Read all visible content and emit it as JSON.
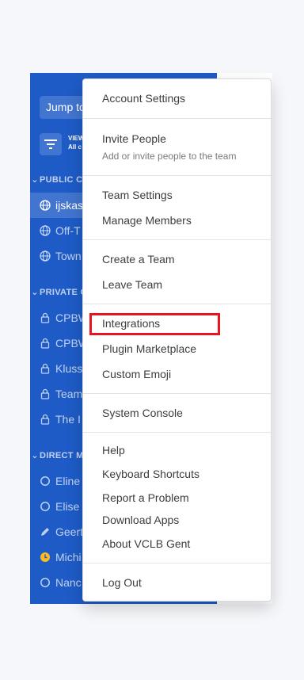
{
  "sidebar": {
    "jump_label": "Jump to...",
    "view_label_line1": "VIEW",
    "view_label_line2": "All c",
    "public_header": "PUBLIC C",
    "private_header": "PRIVATE C",
    "direct_header": "DIRECT M",
    "public_channels": [
      "ijskas",
      "Off-T",
      "Town"
    ],
    "private_channels": [
      "CPBW",
      "CPBW",
      "Kluss",
      "Team",
      "The I"
    ],
    "direct_messages": [
      "Eline",
      "Elise",
      "Geert",
      "Michi",
      "Nanc"
    ]
  },
  "menu": {
    "account_settings": "Account Settings",
    "invite_people": "Invite People",
    "invite_sub": "Add or invite people to the team",
    "team_settings": "Team Settings",
    "manage_members": "Manage Members",
    "create_team": "Create a Team",
    "leave_team": "Leave Team",
    "integrations": "Integrations",
    "plugin_marketplace": "Plugin Marketplace",
    "custom_emoji": "Custom Emoji",
    "system_console": "System Console",
    "help": "Help",
    "keyboard_shortcuts": "Keyboard Shortcuts",
    "report_problem": "Report a Problem",
    "download_apps": "Download Apps",
    "about": "About VCLB Gent",
    "log_out": "Log Out"
  },
  "colors": {
    "sidebar_bg": "#1e5bc6",
    "highlight": "#e8141f",
    "away_status": "#ffbc1f"
  }
}
